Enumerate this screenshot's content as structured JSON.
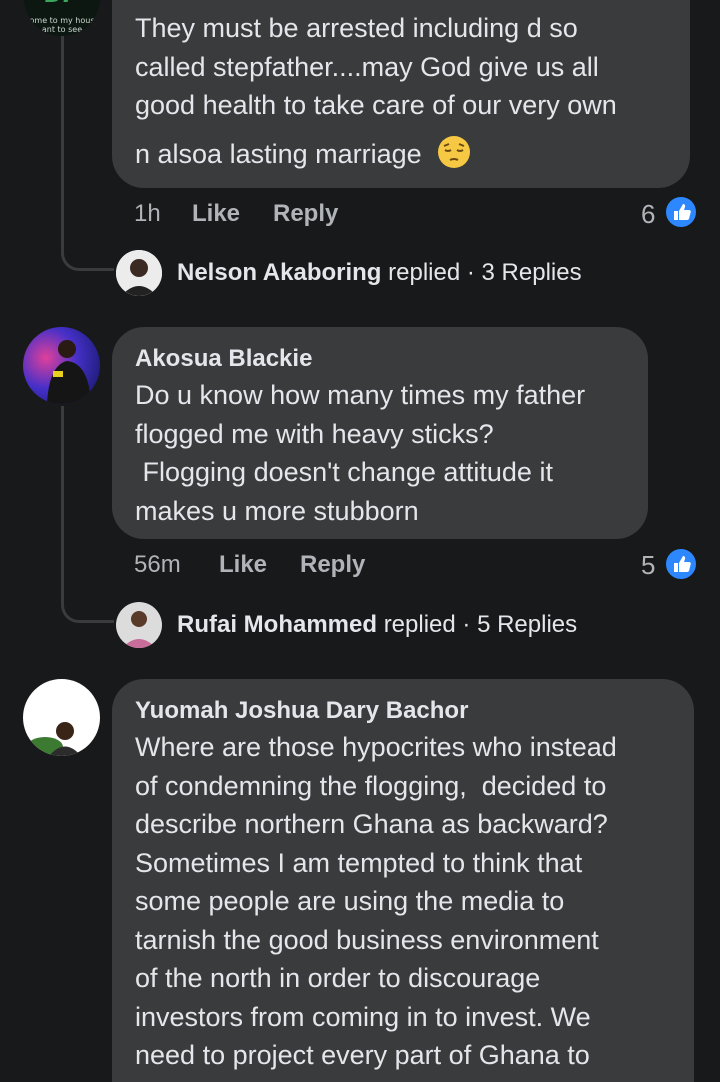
{
  "comments": [
    {
      "avatar_caption_lines": [
        "ome to my hous",
        "ant to see"
      ],
      "text_lines": [
        "They must be arrested including d so",
        "called stepfather....may God give us all",
        "good health to take care of our very own",
        "n alsoa lasting marriage"
      ],
      "emoji": "pensive-face",
      "time": "1h",
      "like_label": "Like",
      "reply_label": "Reply",
      "reaction_count": "6",
      "replies": {
        "name": "Nelson Akaboring",
        "verb": "replied",
        "separator": "·",
        "count_label": "3 Replies"
      }
    },
    {
      "author": "Akosua Blackie",
      "text_lines": [
        "Do u know how many times my father",
        "flogged me with heavy sticks?",
        " Flogging doesn't change attitude it",
        "makes u more stubborn"
      ],
      "time": "56m",
      "like_label": "Like",
      "reply_label": "Reply",
      "reaction_count": "5",
      "replies": {
        "name": "Rufai Mohammed",
        "verb": "replied",
        "separator": "·",
        "count_label": "5 Replies"
      }
    },
    {
      "author": "Yuomah Joshua Dary Bachor",
      "text_lines": [
        "Where are those hypocrites who instead",
        "of condemning the flogging,  decided to",
        "describe northern Ghana as backward?",
        "Sometimes I am tempted to think that",
        "some people are using the media to",
        "tarnish the good business environment",
        "of the north in order to discourage",
        "investors from coming in to invest. We",
        "need to project every part of Ghana to"
      ]
    }
  ],
  "colors": {
    "background": "#18191a",
    "bubble": "#3a3b3c",
    "primary_text": "#e4e6eb",
    "secondary_text": "#b0b3b8",
    "like_blue": "#2d88ff"
  }
}
